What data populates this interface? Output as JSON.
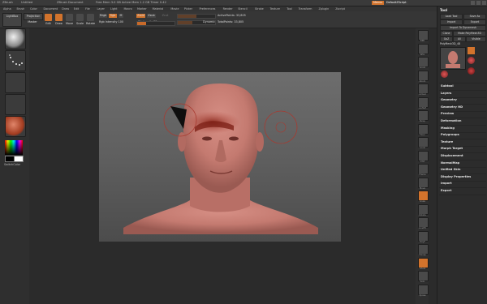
{
  "titlebar": {
    "app": "ZBrush",
    "doc": "Untitled",
    "doc_tag": "ZBrush Document",
    "stats": "Free Mem 3.0 GB   Active Mem 1.2 GB   Timer 0.42",
    "menus_label": "Menus",
    "script_label": "DefaultZScript"
  },
  "menubar": {
    "items": [
      "Alpha",
      "Brush",
      "Color",
      "Document",
      "Draw",
      "Edit",
      "File",
      "Layer",
      "Light",
      "Macro",
      "Marker",
      "Material",
      "Movie",
      "Picker",
      "Preferences",
      "Render",
      "Stencil",
      "Stroke",
      "Texture",
      "Tool",
      "Transform",
      "Zplugin",
      "Zscript"
    ]
  },
  "toolbar": {
    "lightbox": "LightBox",
    "projection": "Projection",
    "master": "Master",
    "edit": "Edit",
    "draw": "Draw",
    "move": "Move",
    "scale": "Scale",
    "rotate": "Rotate",
    "mrgb": "Mrgb",
    "rgb": "Rgb",
    "m": "M",
    "zadd": "Zadd",
    "zsub": "Zsub",
    "zcut": "Zcut",
    "rgb_intensity_label": "Rgb Intensity 100",
    "z_intensity_label": "Z Intensity 25",
    "focal_shift_label": "Focal Shift 0",
    "draw_size_label": "Draw Size 64",
    "dynamic": "Dynamic",
    "active_points_label": "ActivePoints: 33,805",
    "total_points_label": "TotalPoints: 33,805"
  },
  "left": {
    "material_label": "",
    "alpha_label": "",
    "texture_label": "",
    "swatch_label": "SwitchColor",
    "gradient_label": "Gradient"
  },
  "right_shelf": {
    "items": [
      "BPR",
      "SPix",
      "Scroll",
      "Zoom",
      "Actual",
      "AAHalf",
      "Persp",
      "Floor",
      "Local",
      "XYZ",
      "Frame",
      "Move",
      "Scale",
      "Rotate",
      "LineFill",
      "PolyF",
      "Transp",
      "Ghost",
      "Solo",
      "Xpose"
    ]
  },
  "tool": {
    "title": "Tool",
    "load_tool": "Load Tool",
    "save_as": "Save As",
    "import": "Import",
    "export": "Export",
    "import_to_zbrush": "Import To Dynamesh",
    "clone": "Clone",
    "make_polymesh": "Make PolyMesh3D",
    "goz": "GoZ",
    "all": "All",
    "visible": "Visible",
    "current_tool": "PolyMesh3D_48",
    "thumbs": [
      "PolyMesh3D",
      "SimpleBrush",
      "Sphere3D",
      "PolyMesh3D"
    ],
    "sections": [
      "Subtool",
      "Layers",
      "Geometry",
      "Geometry HD",
      "Preview",
      "Deformation",
      "Masking",
      "Polygroups",
      "Texture",
      "Morph Target",
      "Displacement",
      "NormalMap",
      "Unified Skin",
      "Display Properties",
      "Import",
      "Export"
    ]
  },
  "colors": {
    "accent": "#d2732c",
    "panel": "#2c2c2c",
    "skin": "#c47a70",
    "canvas_top": "#6d6d6d"
  }
}
